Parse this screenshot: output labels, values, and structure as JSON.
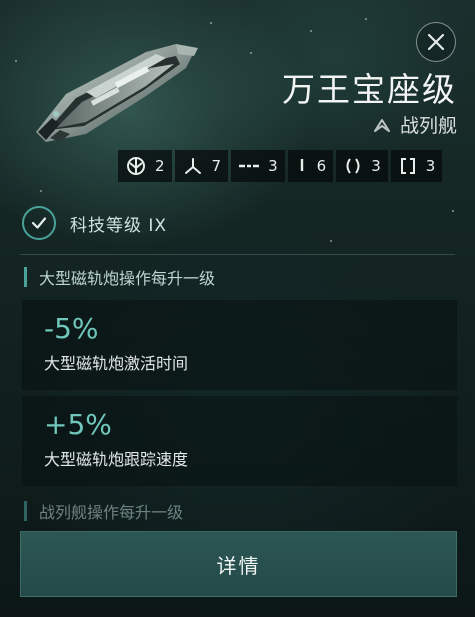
{
  "header": {
    "ship_name": "万王宝座级",
    "ship_class": "战列舰",
    "class_icon": "chevron-up-icon",
    "close_icon": "close-icon"
  },
  "slots": [
    {
      "icon": "high-slot-icon",
      "value": "2"
    },
    {
      "icon": "turret-icon",
      "value": "7"
    },
    {
      "icon": "mid-slot-icon",
      "value": "3"
    },
    {
      "icon": "low-slot-icon",
      "value": "6"
    },
    {
      "icon": "drone-icon",
      "value": "3"
    },
    {
      "icon": "rig-icon",
      "value": "3"
    }
  ],
  "skill": {
    "label": "科技等级 IX",
    "icon": "checkmark-icon"
  },
  "section": {
    "title": "大型磁轨炮操作每升一级"
  },
  "bonuses": [
    {
      "value": "-5%",
      "text": "大型磁轨炮激活时间"
    },
    {
      "value": "+5%",
      "text": "大型磁轨炮跟踪速度"
    }
  ],
  "next_section": {
    "title": "战列舰操作每升一级"
  },
  "footer": {
    "details_label": "详情"
  },
  "colors": {
    "accent": "#4aa39a",
    "bonus_value": "#6fc7bc"
  }
}
